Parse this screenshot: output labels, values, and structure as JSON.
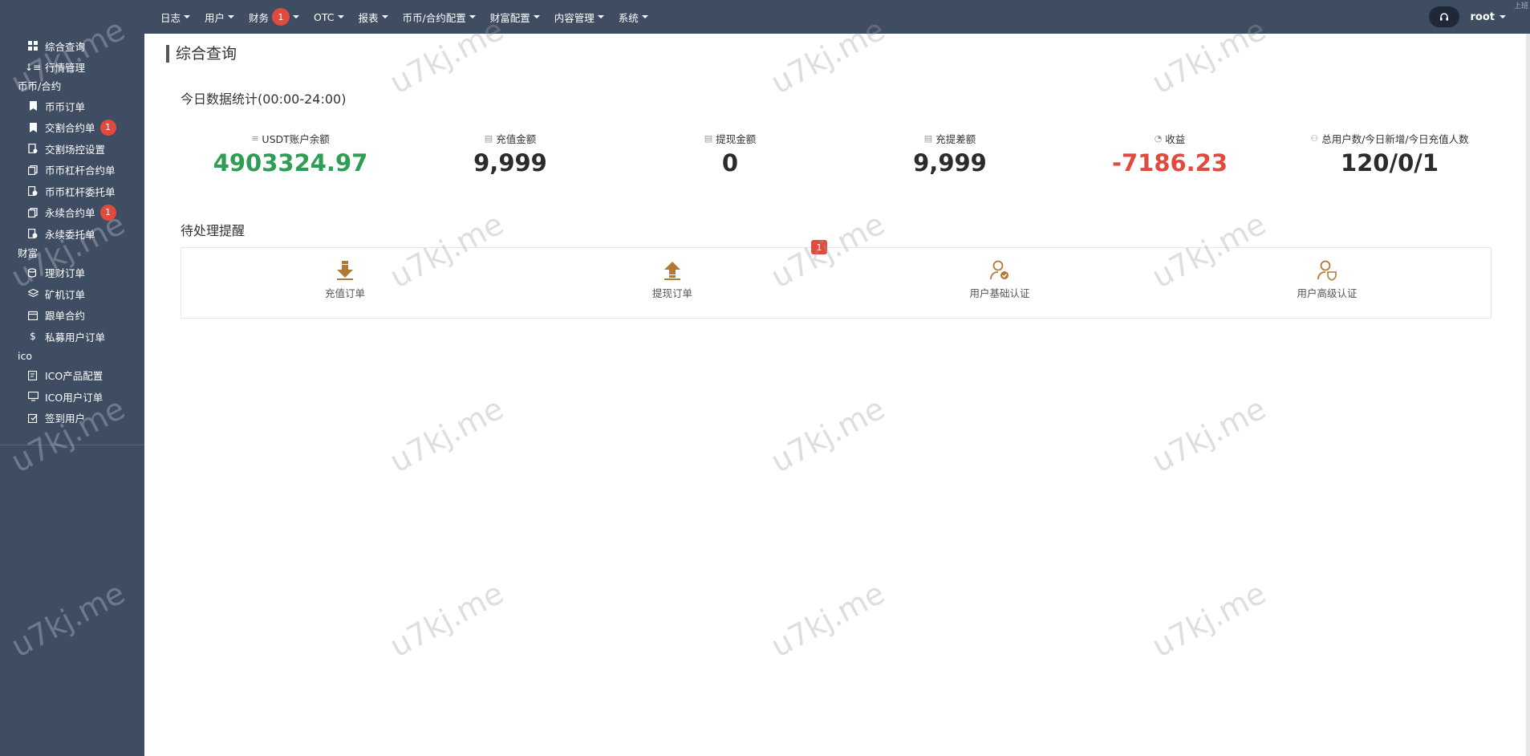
{
  "topbar": {
    "nav": [
      {
        "label": "日志",
        "badge": null
      },
      {
        "label": "用户",
        "badge": null
      },
      {
        "label": "财务",
        "badge": "1"
      },
      {
        "label": "OTC",
        "badge": null
      },
      {
        "label": "报表",
        "badge": null
      },
      {
        "label": "币币/合约配置",
        "badge": null
      },
      {
        "label": "财富配置",
        "badge": null
      },
      {
        "label": "内容管理",
        "badge": null
      },
      {
        "label": "系统",
        "badge": null
      }
    ],
    "user": "root",
    "corner_text": "上班"
  },
  "sidebar": {
    "items": [
      {
        "label": "综合查询",
        "icon": "dashboard-icon"
      },
      {
        "label": "行情管理",
        "icon": "sort-icon"
      }
    ],
    "section_coin": "币币/合约",
    "coin_items": [
      {
        "label": "币币订单",
        "icon": "bookmark-icon",
        "badge": null
      },
      {
        "label": "交割合约单",
        "icon": "bookmark-icon",
        "badge": "1"
      },
      {
        "label": "交割场控设置",
        "icon": "settings-doc-icon",
        "badge": null
      },
      {
        "label": "币币杠杆合约单",
        "icon": "copy-icon",
        "badge": null
      },
      {
        "label": "币币杠杆委托单",
        "icon": "clock-doc-icon",
        "badge": null
      },
      {
        "label": "永续合约单",
        "icon": "copy-icon",
        "badge": "1"
      },
      {
        "label": "永续委托单",
        "icon": "clock-doc-icon",
        "badge": null
      }
    ],
    "section_wealth": "财富",
    "wealth_items": [
      {
        "label": "理财订单",
        "icon": "coins-icon"
      },
      {
        "label": "矿机订单",
        "icon": "layers-icon"
      },
      {
        "label": "跟单合约",
        "icon": "calendar-icon"
      },
      {
        "label": "私募用户订单",
        "icon": "dollar-icon"
      }
    ],
    "section_ico": "ico",
    "ico_items": [
      {
        "label": "ICO产品配置",
        "icon": "edit-doc-icon"
      },
      {
        "label": "ICO用户订单",
        "icon": "monitor-icon"
      },
      {
        "label": "签到用户",
        "icon": "checkin-icon"
      }
    ]
  },
  "main": {
    "page_title": "综合查询",
    "stats_title": "今日数据统计(00:00-24:00)",
    "stats": [
      {
        "label": "USDT账户余额",
        "value": "4903324.97",
        "color": "#2e9e55"
      },
      {
        "label": "充值金额",
        "value": "9,999",
        "color": "#2b2b2b"
      },
      {
        "label": "提现金额",
        "value": "0",
        "color": "#2b2b2b"
      },
      {
        "label": "充提差额",
        "value": "9,999",
        "color": "#2b2b2b"
      },
      {
        "label": "收益",
        "value": "-7186.23",
        "color": "#e04b3e"
      },
      {
        "label": "总用户数/今日新增/今日充值人数",
        "value": "120/0/1",
        "color": "#2b2b2b"
      }
    ],
    "todo_title": "待处理提醒",
    "todo": [
      {
        "label": "充值订单",
        "icon": "arrow-down-icon"
      },
      {
        "label": "提现订单",
        "icon": "arrow-up-icon"
      },
      {
        "label": "用户基础认证",
        "icon": "user-check-icon"
      },
      {
        "label": "用户高级认证",
        "icon": "user-shield-icon"
      }
    ],
    "todo_badge": "1"
  },
  "watermark": "u7kj.me",
  "colors": {
    "sidebar_bg": "#3f4d62",
    "badge": "#e04b3e",
    "positive": "#2e9e55",
    "negative": "#e04b3e",
    "todo_icon": "#b07a36"
  }
}
